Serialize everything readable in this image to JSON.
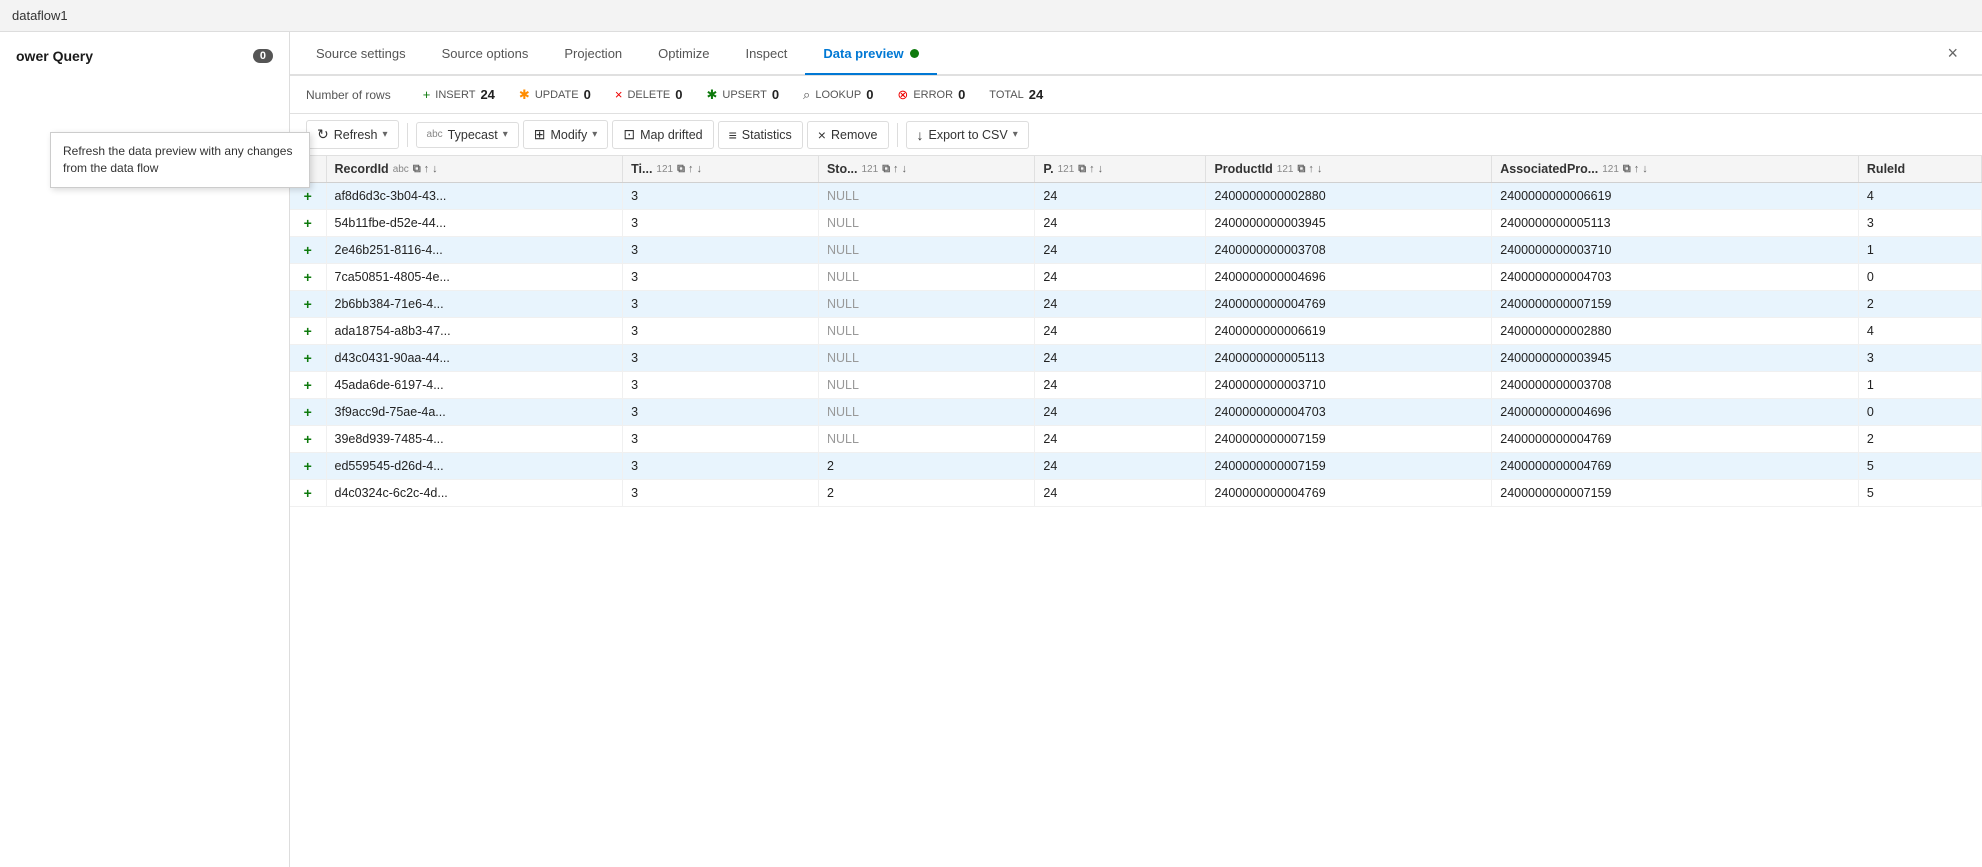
{
  "titleBar": {
    "text": "dataflow1"
  },
  "sidebar": {
    "title": "ower Query",
    "badge": "0"
  },
  "tooltip": {
    "text": "Refresh the data preview with any changes from the data flow"
  },
  "tabs": [
    {
      "id": "source-settings",
      "label": "Source settings",
      "active": false
    },
    {
      "id": "source-options",
      "label": "Source options",
      "active": false
    },
    {
      "id": "projection",
      "label": "Projection",
      "active": false
    },
    {
      "id": "optimize",
      "label": "Optimize",
      "active": false
    },
    {
      "id": "inspect",
      "label": "Inspect",
      "active": false
    },
    {
      "id": "data-preview",
      "label": "Data preview",
      "active": true
    }
  ],
  "stats": {
    "numRowsLabel": "Number of rows",
    "insert": {
      "icon": "+",
      "label": "INSERT",
      "value": "24"
    },
    "update": {
      "icon": "✱",
      "label": "UPDATE",
      "value": "0"
    },
    "delete": {
      "icon": "×",
      "label": "DELETE",
      "value": "0"
    },
    "upsert": {
      "icon": "✱",
      "label": "UPSERT",
      "value": "0"
    },
    "lookup": {
      "icon": "⌕",
      "label": "LOOKUP",
      "value": "0"
    },
    "error": {
      "icon": "⊗",
      "label": "ERROR",
      "value": "0"
    },
    "total": {
      "label": "TOTAL",
      "value": "24"
    }
  },
  "toolbar": {
    "refresh": "Refresh",
    "typecast": "Typecast",
    "modify": "Modify",
    "mapDrifted": "Map drifted",
    "statistics": "Statistics",
    "remove": "Remove",
    "exportToCsv": "Export to CSV"
  },
  "columns": [
    {
      "name": "RecordId",
      "type": "abc"
    },
    {
      "name": "Ti...",
      "type": "121"
    },
    {
      "name": "Sto...",
      "type": "121"
    },
    {
      "name": "P.",
      "type": "121"
    },
    {
      "name": "ProductId",
      "type": "121"
    },
    {
      "name": "AssociatedPro...",
      "type": "121"
    },
    {
      "name": "RuleId",
      "type": ""
    }
  ],
  "rows": [
    {
      "id": 1,
      "recordId": "af8d6d3c-3b04-43...",
      "ti": "3",
      "sto": "NULL",
      "p": "24",
      "productId": "2400000000002880",
      "assocPro": "2400000000006619",
      "ruleId": "4"
    },
    {
      "id": 2,
      "recordId": "54b11fbe-d52e-44...",
      "ti": "3",
      "sto": "NULL",
      "p": "24",
      "productId": "2400000000003945",
      "assocPro": "2400000000005113",
      "ruleId": "3"
    },
    {
      "id": 3,
      "recordId": "2e46b251-8116-4...",
      "ti": "3",
      "sto": "NULL",
      "p": "24",
      "productId": "2400000000003708",
      "assocPro": "2400000000003710",
      "ruleId": "1"
    },
    {
      "id": 4,
      "recordId": "7ca50851-4805-4e...",
      "ti": "3",
      "sto": "NULL",
      "p": "24",
      "productId": "2400000000004696",
      "assocPro": "2400000000004703",
      "ruleId": "0"
    },
    {
      "id": 5,
      "recordId": "2b6bb384-71e6-4...",
      "ti": "3",
      "sto": "NULL",
      "p": "24",
      "productId": "2400000000004769",
      "assocPro": "2400000000007159",
      "ruleId": "2"
    },
    {
      "id": 6,
      "recordId": "ada18754-a8b3-47...",
      "ti": "3",
      "sto": "NULL",
      "p": "24",
      "productId": "2400000000006619",
      "assocPro": "2400000000002880",
      "ruleId": "4"
    },
    {
      "id": 7,
      "recordId": "d43c0431-90aa-44...",
      "ti": "3",
      "sto": "NULL",
      "p": "24",
      "productId": "2400000000005113",
      "assocPro": "2400000000003945",
      "ruleId": "3"
    },
    {
      "id": 8,
      "recordId": "45ada6de-6197-4...",
      "ti": "3",
      "sto": "NULL",
      "p": "24",
      "productId": "2400000000003710",
      "assocPro": "2400000000003708",
      "ruleId": "1"
    },
    {
      "id": 9,
      "recordId": "3f9acc9d-75ae-4a...",
      "ti": "3",
      "sto": "NULL",
      "p": "24",
      "productId": "2400000000004703",
      "assocPro": "2400000000004696",
      "ruleId": "0"
    },
    {
      "id": 10,
      "recordId": "39e8d939-7485-4...",
      "ti": "3",
      "sto": "NULL",
      "p": "24",
      "productId": "2400000000007159",
      "assocPro": "2400000000004769",
      "ruleId": "2"
    },
    {
      "id": 11,
      "recordId": "ed559545-d26d-4...",
      "ti": "3",
      "sto": "2",
      "p": "24",
      "productId": "2400000000007159",
      "assocPro": "2400000000004769",
      "ruleId": "5"
    },
    {
      "id": 12,
      "recordId": "d4c0324c-6c2c-4d...",
      "ti": "3",
      "sto": "2",
      "p": "24",
      "productId": "2400000000004769",
      "assocPro": "2400000000007159",
      "ruleId": "5"
    }
  ]
}
